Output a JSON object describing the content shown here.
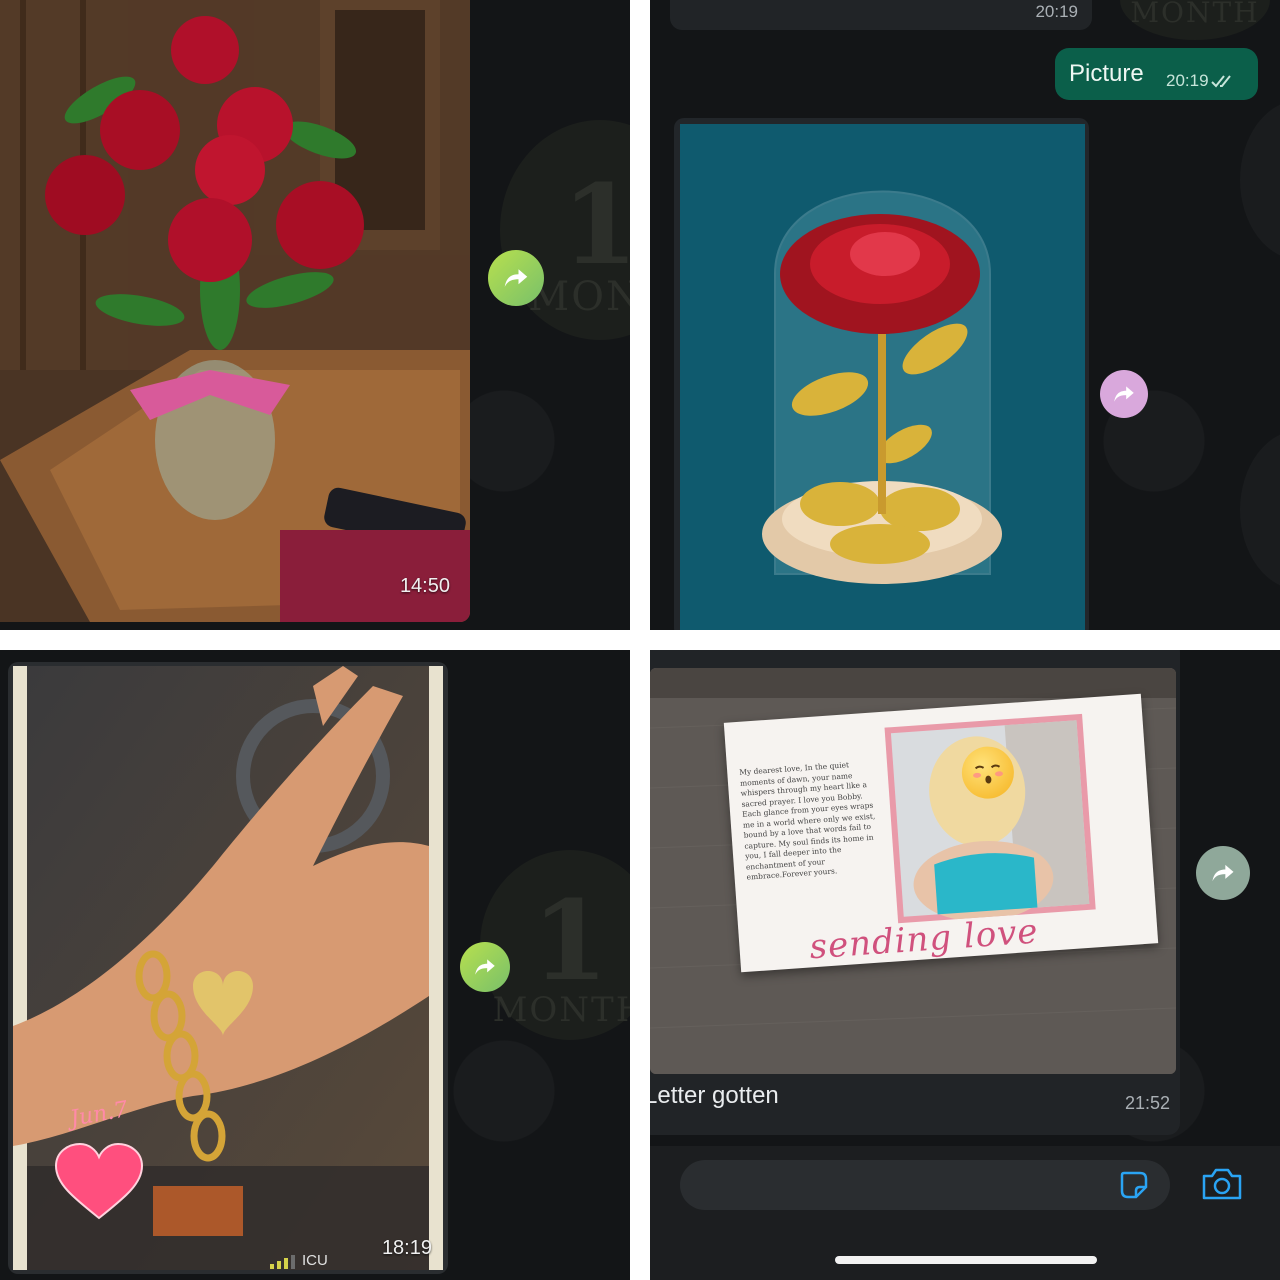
{
  "panels": {
    "top_left": {
      "image_timestamp": "14:50",
      "deco_number": "1",
      "deco_label": "MONT",
      "icons": {
        "forward": "forward-arrow-icon"
      },
      "colors": {
        "forward_button": "#9fcf4a"
      }
    },
    "top_right": {
      "incoming_timestamp": "20:19",
      "outgoing_message": {
        "text": "Picture",
        "timestamp": "20:19",
        "status": "read"
      },
      "deco_label": "MONTH",
      "icons": {
        "forward": "forward-arrow-icon",
        "read_receipt": "double-check-icon"
      },
      "colors": {
        "outgoing_bubble": "#0b5f4a",
        "forward_button": "#d9a8dc"
      }
    },
    "bottom_left": {
      "image_timestamp": "18:19",
      "overlay_text": "Jun.7",
      "status_text": "ICU",
      "deco_number": "1",
      "deco_label": "MONTH",
      "icons": {
        "forward": "forward-arrow-icon",
        "signal": "signal-bars-icon",
        "heart": "heart-icon"
      },
      "colors": {
        "forward_button": "#9fcf4a",
        "heart": "#ff4f7e"
      }
    },
    "bottom_right": {
      "letter": {
        "body": "My dearest love, In the quiet moments of dawn, your name whispers through my heart like a sacred prayer. I love you Bobby. Each glance from your eyes wraps me in a world where only we exist, bound by a love that words fail to capture. My soul finds its home in you, I fall deeper into the enchantment of your embrace.Forever yours.",
        "script_text": "sending love"
      },
      "caption": "Letter gotten",
      "timestamp": "21:52",
      "icons": {
        "forward": "forward-arrow-icon",
        "sticker": "sticker-icon",
        "camera": "camera-icon",
        "emoji": "kissing-face-emoji"
      },
      "colors": {
        "forward_button": "#8fa89a",
        "accent": "#2aa4f4"
      }
    }
  }
}
